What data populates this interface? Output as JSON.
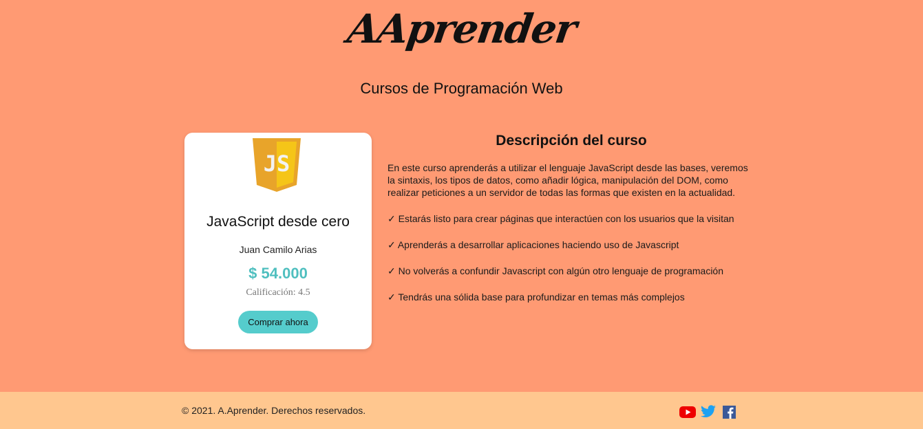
{
  "brand": {
    "logo_text": "AAprender"
  },
  "header": {
    "subtitle": "Cursos de Programación Web"
  },
  "card": {
    "logo_icon": "js-logo-icon",
    "title": "JavaScript desde cero",
    "author": "Juan Camilo Arias",
    "price": "$ 54.000",
    "rating": "Calificación: 4.5",
    "buy_label": "Comprar ahora"
  },
  "description": {
    "title": "Descripción del curso",
    "body": "En este curso aprenderás a utilizar el lenguaje JavaScript desde las bases, veremos la sintaxis, los tipos de datos, como añadir lógica, manipulación del DOM, como realizar peticiones a un servidor de todas las formas que existen en la actualidad.",
    "items": [
      "✓ Estarás listo para crear páginas que interactúen con los usuarios que la visitan",
      "✓ Aprenderás a desarrollar aplicaciones haciendo uso de Javascript",
      "✓ No volverás a confundir Javascript con algún otro lenguaje de programación",
      "✓ Tendrás una sólida base para profundizar en temas más complejos"
    ]
  },
  "footer": {
    "copyright": "© 2021. A.Aprender. Derechos reservados.",
    "socials": [
      "youtube-icon",
      "twitter-icon",
      "facebook-icon"
    ]
  },
  "colors": {
    "background": "#ff9a73",
    "footer": "#ffc78f",
    "accent": "#4fbfbf",
    "button": "#55cccc"
  }
}
